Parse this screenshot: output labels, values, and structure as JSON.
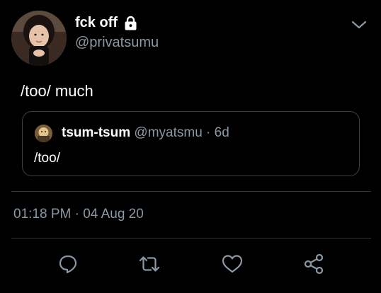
{
  "author": {
    "display_name": "fck off",
    "handle": "@privatsumu",
    "protected_icon": "lock-icon"
  },
  "tweet": {
    "text": "/too/ much",
    "timestamp": "01:18 PM · 04 Aug 20"
  },
  "quoted_tweet": {
    "name": "tsum-tsum",
    "handle": "@myatsmu",
    "separator": "·",
    "time": "6d",
    "text": "/too/"
  },
  "actions": [
    {
      "name": "reply",
      "icon": "reply-icon"
    },
    {
      "name": "retweet",
      "icon": "retweet-icon"
    },
    {
      "name": "like",
      "icon": "heart-icon"
    },
    {
      "name": "share",
      "icon": "share-icon"
    }
  ],
  "colors": {
    "background": "#000000",
    "text_primary": "#ffffff",
    "text_secondary": "#8b98a5",
    "border": "#38444d",
    "divider": "#2f3336"
  }
}
